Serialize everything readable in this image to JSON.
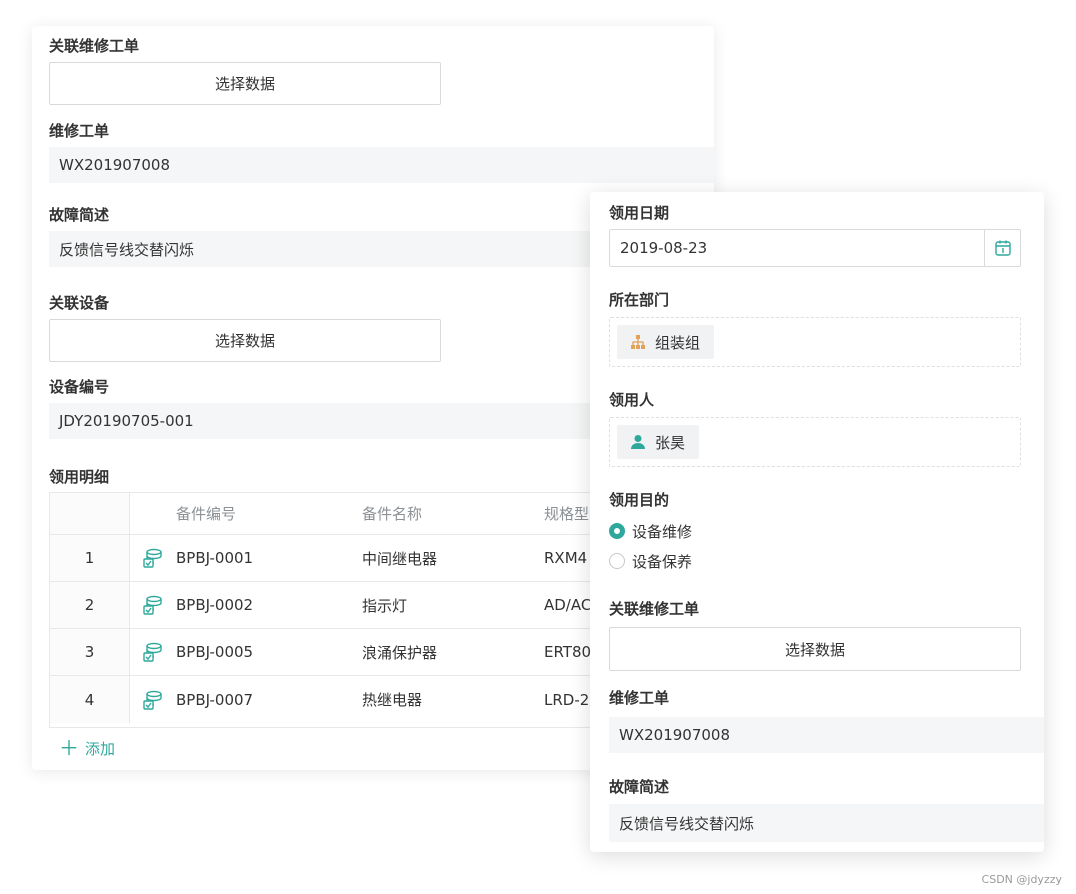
{
  "back_form": {
    "related_work_order_label": "关联维修工单",
    "related_work_order_button": "选择数据",
    "work_order_label": "维修工单",
    "work_order_value": "WX201907008",
    "fault_label": "故障简述",
    "fault_value": "反馈信号线交替闪烁",
    "related_device_label": "关联设备",
    "related_device_button": "选择数据",
    "device_no_label": "设备编号",
    "device_no_value": "JDY20190705-001",
    "detail_label": "领用明细",
    "table": {
      "columns": [
        "备件编号",
        "备件名称",
        "规格型"
      ],
      "rows": [
        {
          "index": "1",
          "code": "BPBJ-0001",
          "name": "中间继电器",
          "spec": "RXM4"
        },
        {
          "index": "2",
          "code": "BPBJ-0002",
          "name": "指示灯",
          "spec": "AD/AC"
        },
        {
          "index": "3",
          "code": "BPBJ-0005",
          "name": "浪涌保护器",
          "spec": "ERT80"
        },
        {
          "index": "4",
          "code": "BPBJ-0007",
          "name": "热继电器",
          "spec": "LRD-2"
        }
      ]
    },
    "add_label": "添加"
  },
  "front_form": {
    "date_label": "领用日期",
    "date_value": "2019-08-23",
    "department_label": "所在部门",
    "department_value": "组装组",
    "person_label": "领用人",
    "person_value": "张昊",
    "purpose_label": "领用目的",
    "purpose_options": [
      {
        "label": "设备维修",
        "selected": true
      },
      {
        "label": "设备保养",
        "selected": false
      }
    ],
    "related_work_order_label": "关联维修工单",
    "related_work_order_button": "选择数据",
    "work_order_label": "维修工单",
    "work_order_value": "WX201907008",
    "fault_label": "故障简述",
    "fault_value": "反馈信号线交替闪烁"
  },
  "watermark": "CSDN @jdyzzy",
  "icons": {
    "part": "stacked-parts-icon",
    "calendar": "calendar-icon",
    "department": "org-tree-icon",
    "person": "user-icon",
    "add": "plus-icon"
  },
  "colors": {
    "accent": "#2fa89c",
    "department_icon": "#e3a25a",
    "readonly_bg": "#f5f6f7",
    "border": "#d7dadd"
  }
}
